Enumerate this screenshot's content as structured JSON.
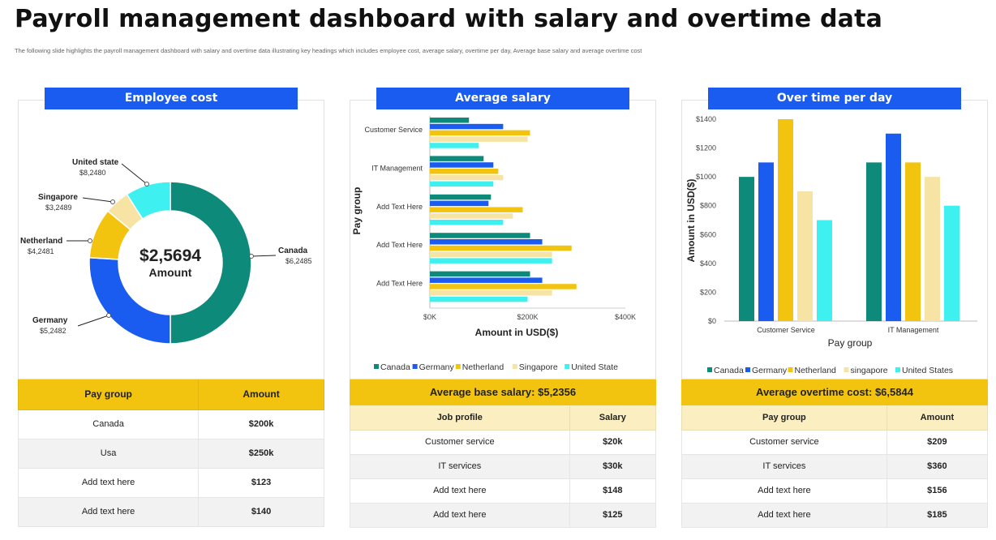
{
  "title": "Payroll management dashboard with salary and overtime data",
  "subtitle": "The  following slide highlights  the payroll management  dashboard with salary and overtime data illustrating key headings which  includes employee cost, average salary, overtime per day, Average base salary and average overtime cost",
  "colors": {
    "canada": "#0e8a7a",
    "germany": "#1a5cf0",
    "netherland": "#f2c40f",
    "singapore": "#f7e3a4",
    "united_state": "#3ff0f0",
    "header_blue": "#1a5cf0",
    "table_header": "#f2c40f"
  },
  "employee_cost": {
    "header": "Employee cost",
    "center_value": "$2,5694",
    "center_label": "Amount",
    "table": {
      "columns": [
        "Pay group",
        "Amount"
      ],
      "rows": [
        [
          "Canada",
          "$200k"
        ],
        [
          "Usa",
          "$250k"
        ],
        [
          "Add text here",
          "$123"
        ],
        [
          "Add text here",
          "$140"
        ]
      ]
    }
  },
  "average_salary": {
    "header": "Average salary",
    "banner": "Average base salary: $5,2356",
    "table": {
      "columns": [
        "Job profile",
        "Salary"
      ],
      "rows": [
        [
          "Customer service",
          "$20k"
        ],
        [
          "IT services",
          "$30k"
        ],
        [
          "Add text here",
          "$148"
        ],
        [
          "Add text here",
          "$125"
        ]
      ]
    }
  },
  "overtime": {
    "header": "Over time per day",
    "banner": "Average overtime cost: $6,5844",
    "table": {
      "columns": [
        "Pay group",
        "Amount"
      ],
      "rows": [
        [
          "Customer service",
          "$209"
        ],
        [
          "IT services",
          "$360"
        ],
        [
          "Add text here",
          "$156"
        ],
        [
          "Add text here",
          "$185"
        ]
      ]
    }
  },
  "chart_data": [
    {
      "type": "pie",
      "subtype": "donut",
      "slices": [
        {
          "name": "Canada",
          "label": "$6,2485",
          "value": 50,
          "color": "#0e8a7a"
        },
        {
          "name": "Germany",
          "label": "$5,2482",
          "value": 26,
          "color": "#1a5cf0"
        },
        {
          "name": "Netherland",
          "label": "$4,2481",
          "value": 10,
          "color": "#f2c40f"
        },
        {
          "name": "Singapore",
          "label": "$3,2489",
          "value": 5,
          "color": "#f7e3a4"
        },
        {
          "name": "United state",
          "label": "$8,2480",
          "value": 9,
          "color": "#3ff0f0"
        }
      ]
    },
    {
      "type": "bar",
      "orientation": "horizontal",
      "categories": [
        "Customer Service",
        "IT Management",
        "Add Text Here",
        "Add Text Here",
        "Add Text Here"
      ],
      "series": [
        {
          "name": "Canada",
          "color": "#0e8a7a",
          "values": [
            80,
            110,
            125,
            205,
            205
          ]
        },
        {
          "name": "Germany",
          "color": "#1a5cf0",
          "values": [
            150,
            130,
            120,
            230,
            230
          ]
        },
        {
          "name": "Netherland",
          "color": "#f2c40f",
          "values": [
            205,
            140,
            190,
            290,
            300
          ]
        },
        {
          "name": "Singapore",
          "color": "#f7e3a4",
          "values": [
            200,
            150,
            170,
            250,
            250
          ]
        },
        {
          "name": "United State",
          "color": "#3ff0f0",
          "values": [
            100,
            130,
            150,
            250,
            200
          ]
        }
      ],
      "xlabel": "Amount  in USD($)",
      "ylabel": "Pay group",
      "xlim": [
        0,
        400
      ],
      "xticks": [
        "$0K",
        "$200K",
        "$400K"
      ],
      "legend": "bottom"
    },
    {
      "type": "bar",
      "categories": [
        "Customer Service",
        "IT Management"
      ],
      "series": [
        {
          "name": "Canada",
          "color": "#0e8a7a",
          "values": [
            1000,
            1100
          ]
        },
        {
          "name": "Germany",
          "color": "#1a5cf0",
          "values": [
            1100,
            1300
          ]
        },
        {
          "name": "Netherland",
          "color": "#f2c40f",
          "values": [
            1400,
            1100
          ]
        },
        {
          "name": "singapore",
          "color": "#f7e3a4",
          "values": [
            900,
            1000
          ]
        },
        {
          "name": "United States",
          "color": "#3ff0f0",
          "values": [
            700,
            800
          ]
        }
      ],
      "xlabel": "Pay group",
      "ylabel": "Amount in USD($)",
      "ylim": [
        0,
        1400
      ],
      "yticks": [
        "$0",
        "$200",
        "$400",
        "$600",
        "$800",
        "$1000",
        "$1200",
        "$1400"
      ],
      "legend": "bottom"
    }
  ]
}
